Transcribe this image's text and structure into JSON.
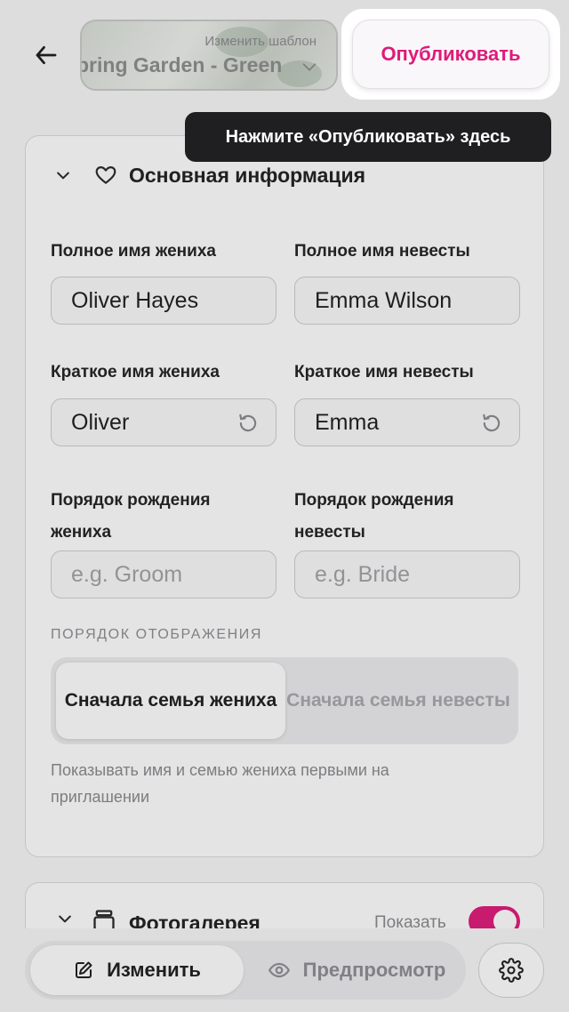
{
  "header": {
    "template_hint": "Изменить шаблон",
    "template_name": "pring Garden - Green",
    "publish_label": "Опубликовать"
  },
  "tooltip": {
    "text": "Нажмите «Опубликовать» здесь"
  },
  "basic_info": {
    "title": "Основная информация",
    "groom_full_name": {
      "label": "Полное имя жениха",
      "value": "Oliver Hayes"
    },
    "bride_full_name": {
      "label": "Полное имя невесты",
      "value": "Emma Wilson"
    },
    "groom_short_name": {
      "label": "Краткое имя жениха",
      "value": "Oliver"
    },
    "bride_short_name": {
      "label": "Краткое имя невесты",
      "value": "Emma"
    },
    "groom_birth_order": {
      "label": "Порядок рождения жениха",
      "placeholder": "e.g. Groom"
    },
    "bride_birth_order": {
      "label": "Порядок рождения невесты",
      "placeholder": "e.g. Bride"
    },
    "display_order": {
      "label": "ПОРЯДОК ОТОБРАЖЕНИЯ",
      "options": [
        "Сначала семья жениха",
        "Сначала семья невесты"
      ],
      "selected": "Сначала семья жениха",
      "note": "Показывать имя и семью жениха первыми на приглашении"
    }
  },
  "gallery": {
    "title": "Фотогалерея",
    "show_label": "Показать",
    "enabled": true
  },
  "bottom_bar": {
    "edit_label": "Изменить",
    "preview_label": "Предпросмотр",
    "active_mode": "edit"
  },
  "colors": {
    "accent": "#e01a7a",
    "tooltip_bg": "#1f1f21"
  },
  "icons": [
    "arrow-left-icon",
    "chevron-down-icon",
    "heart-icon",
    "reset-icon",
    "gallery-icon",
    "edit-icon",
    "eye-icon",
    "gear-icon"
  ]
}
